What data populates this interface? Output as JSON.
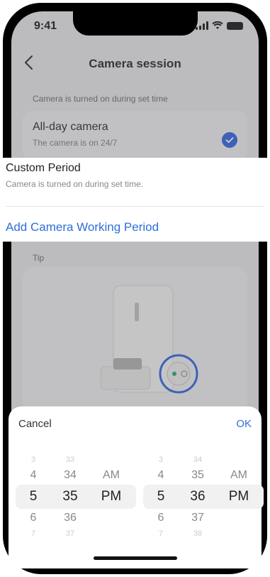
{
  "status": {
    "time": "9:41"
  },
  "nav": {
    "title": "Camera session"
  },
  "section": {
    "label": "Camera is turned on during set time"
  },
  "allday": {
    "title": "All-day camera",
    "subtitle": "The camera is on 24/7",
    "checked": true
  },
  "custom": {
    "title": "Custom Period",
    "subtitle": "Camera is turned on during set time.",
    "add_link": "Add Camera Working Period"
  },
  "tip": {
    "label": "Tip"
  },
  "picker": {
    "cancel": "Cancel",
    "ok": "OK",
    "start": {
      "hour": [
        "3",
        "4",
        "5",
        "6",
        "7"
      ],
      "minute": [
        "33",
        "34",
        "35",
        "36",
        "37"
      ],
      "ampm": [
        "",
        "AM",
        "PM",
        "",
        ""
      ]
    },
    "end": {
      "hour": [
        "3",
        "4",
        "5",
        "6",
        "7"
      ],
      "minute": [
        "34",
        "35",
        "36",
        "37",
        "38"
      ],
      "ampm": [
        "",
        "AM",
        "PM",
        "",
        ""
      ]
    }
  },
  "colors": {
    "accent": "#2d6fd8",
    "check": "#3a6ee8"
  }
}
